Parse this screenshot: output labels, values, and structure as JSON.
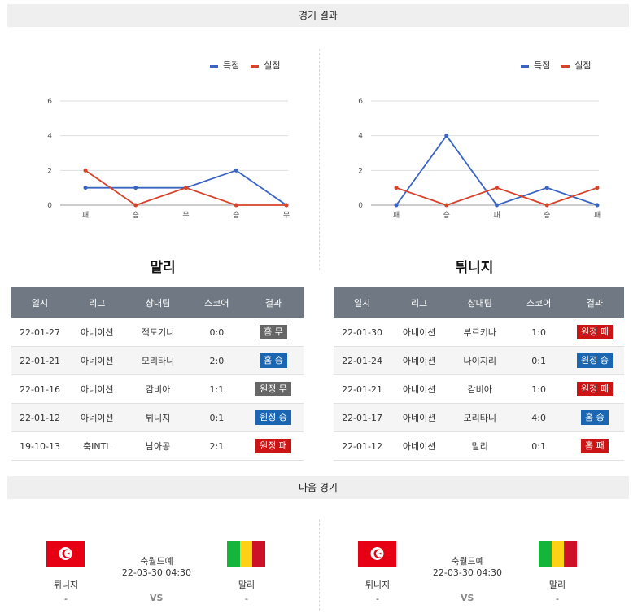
{
  "sections": {
    "results_title": "경기 결과",
    "next_title": "다음 경기"
  },
  "colors": {
    "score": "#3a64c4",
    "concede": "#d6432a",
    "win": "#1a66b3",
    "loss": "#cc1414",
    "draw": "#666666"
  },
  "charts": [
    {
      "legend": {
        "score": "득점",
        "concede": "실점"
      },
      "chart_data": {
        "type": "line",
        "categories": [
          "패",
          "승",
          "무",
          "승",
          "무"
        ],
        "ylim": [
          0,
          6
        ],
        "yticks": [
          0,
          2,
          4,
          6
        ],
        "series": [
          {
            "name": "득점",
            "values": [
              1,
              1,
              1,
              2,
              0
            ]
          },
          {
            "name": "실점",
            "values": [
              2,
              0,
              1,
              0,
              0
            ]
          }
        ]
      }
    },
    {
      "legend": {
        "score": "득점",
        "concede": "실점"
      },
      "chart_data": {
        "type": "line",
        "categories": [
          "패",
          "승",
          "패",
          "승",
          "패"
        ],
        "ylim": [
          0,
          6
        ],
        "yticks": [
          0,
          2,
          4,
          6
        ],
        "series": [
          {
            "name": "득점",
            "values": [
              0,
              4,
              0,
              1,
              0
            ]
          },
          {
            "name": "실점",
            "values": [
              1,
              0,
              1,
              0,
              1
            ]
          }
        ]
      }
    }
  ],
  "tables": [
    {
      "team": "말리",
      "headers": [
        "일시",
        "리그",
        "상대팀",
        "스코어",
        "결과"
      ],
      "rows": [
        {
          "date": "22-01-27",
          "league": "아네이션",
          "opponent": "적도기니",
          "score": "0:0",
          "result": "홈 무",
          "kind": "draw"
        },
        {
          "date": "22-01-21",
          "league": "아네이션",
          "opponent": "모리타니",
          "score": "2:0",
          "result": "홈 승",
          "kind": "win"
        },
        {
          "date": "22-01-16",
          "league": "아네이션",
          "opponent": "감비아",
          "score": "1:1",
          "result": "원정 무",
          "kind": "draw"
        },
        {
          "date": "22-01-12",
          "league": "아네이션",
          "opponent": "튀니지",
          "score": "0:1",
          "result": "원정 승",
          "kind": "win"
        },
        {
          "date": "19-10-13",
          "league": "축INTL",
          "opponent": "남아공",
          "score": "2:1",
          "result": "원정 패",
          "kind": "loss"
        }
      ]
    },
    {
      "team": "튀니지",
      "headers": [
        "일시",
        "리그",
        "상대팀",
        "스코어",
        "결과"
      ],
      "rows": [
        {
          "date": "22-01-30",
          "league": "아네이션",
          "opponent": "부르키나",
          "score": "1:0",
          "result": "원정 패",
          "kind": "loss"
        },
        {
          "date": "22-01-24",
          "league": "아네이션",
          "opponent": "나이지리",
          "score": "0:1",
          "result": "원정 승",
          "kind": "win"
        },
        {
          "date": "22-01-21",
          "league": "아네이션",
          "opponent": "감비아",
          "score": "1:0",
          "result": "원정 패",
          "kind": "loss"
        },
        {
          "date": "22-01-17",
          "league": "아네이션",
          "opponent": "모리타니",
          "score": "4:0",
          "result": "홈 승",
          "kind": "win"
        },
        {
          "date": "22-01-12",
          "league": "아네이션",
          "opponent": "말리",
          "score": "0:1",
          "result": "홈 패",
          "kind": "loss"
        }
      ]
    }
  ],
  "next_matches": [
    {
      "home": "튀니지",
      "away": "말리",
      "league": "축월드예",
      "datetime": "22-03-30 04:30",
      "home_score": "-",
      "away_score": "-",
      "vs": "VS",
      "home_flag": "tunisia-flag",
      "away_flag": "mali-flag"
    },
    {
      "home": "튀니지",
      "away": "말리",
      "league": "축월드예",
      "datetime": "22-03-30 04:30",
      "home_score": "-",
      "away_score": "-",
      "vs": "VS",
      "home_flag": "tunisia-flag",
      "away_flag": "mali-flag"
    }
  ]
}
